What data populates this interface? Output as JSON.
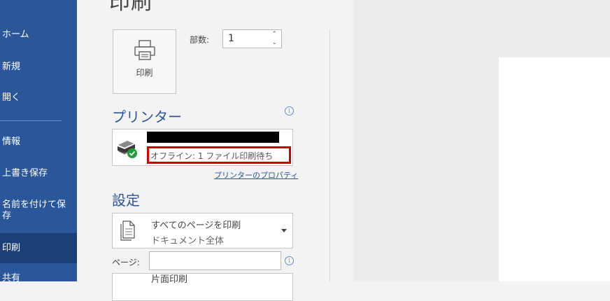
{
  "sidebar": {
    "items": [
      {
        "label": "ホーム"
      },
      {
        "label": "新規"
      },
      {
        "label": "開く"
      },
      {
        "label": "情報"
      },
      {
        "label": "上書き保存"
      },
      {
        "label": "名前を付けて保存"
      },
      {
        "label": "印刷",
        "active": true
      },
      {
        "label": "共有"
      }
    ]
  },
  "page": {
    "title": "印刷"
  },
  "print": {
    "button_label": "印刷",
    "copies_label": "部数:",
    "copies_value": "1"
  },
  "printer": {
    "section_title": "プリンター",
    "name_redacted": true,
    "status": "オフライン: 1 ファイル印刷待ち",
    "properties_link": "プリンターのプロパティ"
  },
  "settings": {
    "section_title": "設定",
    "range": {
      "line1": "すべてのページを印刷",
      "line2": "ドキュメント全体"
    },
    "pages_label": "ページ:",
    "pages_value": "",
    "sides": {
      "line1": "片面印刷"
    }
  },
  "icons": {
    "printer": "printer-icon",
    "printer_ready": "printer-status-icon",
    "info": "info-icon",
    "dropdown": "chevron-down-icon"
  },
  "colors": {
    "sidebar": "#2b579a",
    "sidebar_active": "#1b3f77",
    "accent": "#2b579a",
    "highlight": "#d00000"
  }
}
